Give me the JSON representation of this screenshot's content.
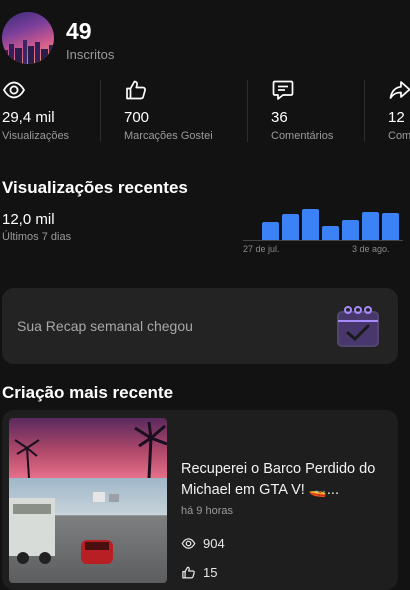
{
  "channel": {
    "subscribers_count": "49",
    "subscribers_label": "Inscritos"
  },
  "stats": [
    {
      "icon": "eye-icon",
      "value": "29,4 mil",
      "label": "Visualizações"
    },
    {
      "icon": "thumbs-up-icon",
      "value": "700",
      "label": "Marcações Gostei"
    },
    {
      "icon": "comment-icon",
      "value": "36",
      "label": "Comentários"
    },
    {
      "icon": "share-icon",
      "value": "12",
      "label": "Com"
    }
  ],
  "recent_views": {
    "title": "Visualizações recentes",
    "total": "12,0 mil",
    "period": "Últimos 7 dias",
    "axis_start": "27 de jul.",
    "axis_end": "3 de ago.",
    "bar_levels": [
      0.55,
      0.8,
      0.97,
      0.45,
      0.62,
      0.88,
      0.83
    ],
    "bar_color": "#3b82f6"
  },
  "recap": {
    "text": "Sua Recap semanal chegou",
    "icon": "calendar-recap-icon",
    "icon_color": "#8b5cf6"
  },
  "latest": {
    "title": "Criação mais recente",
    "video_title": "Recuperei o Barco Perdido do Michael em GTA V! 🚤...",
    "time_ago": "há 9 horas",
    "views": "904",
    "likes": "15"
  }
}
